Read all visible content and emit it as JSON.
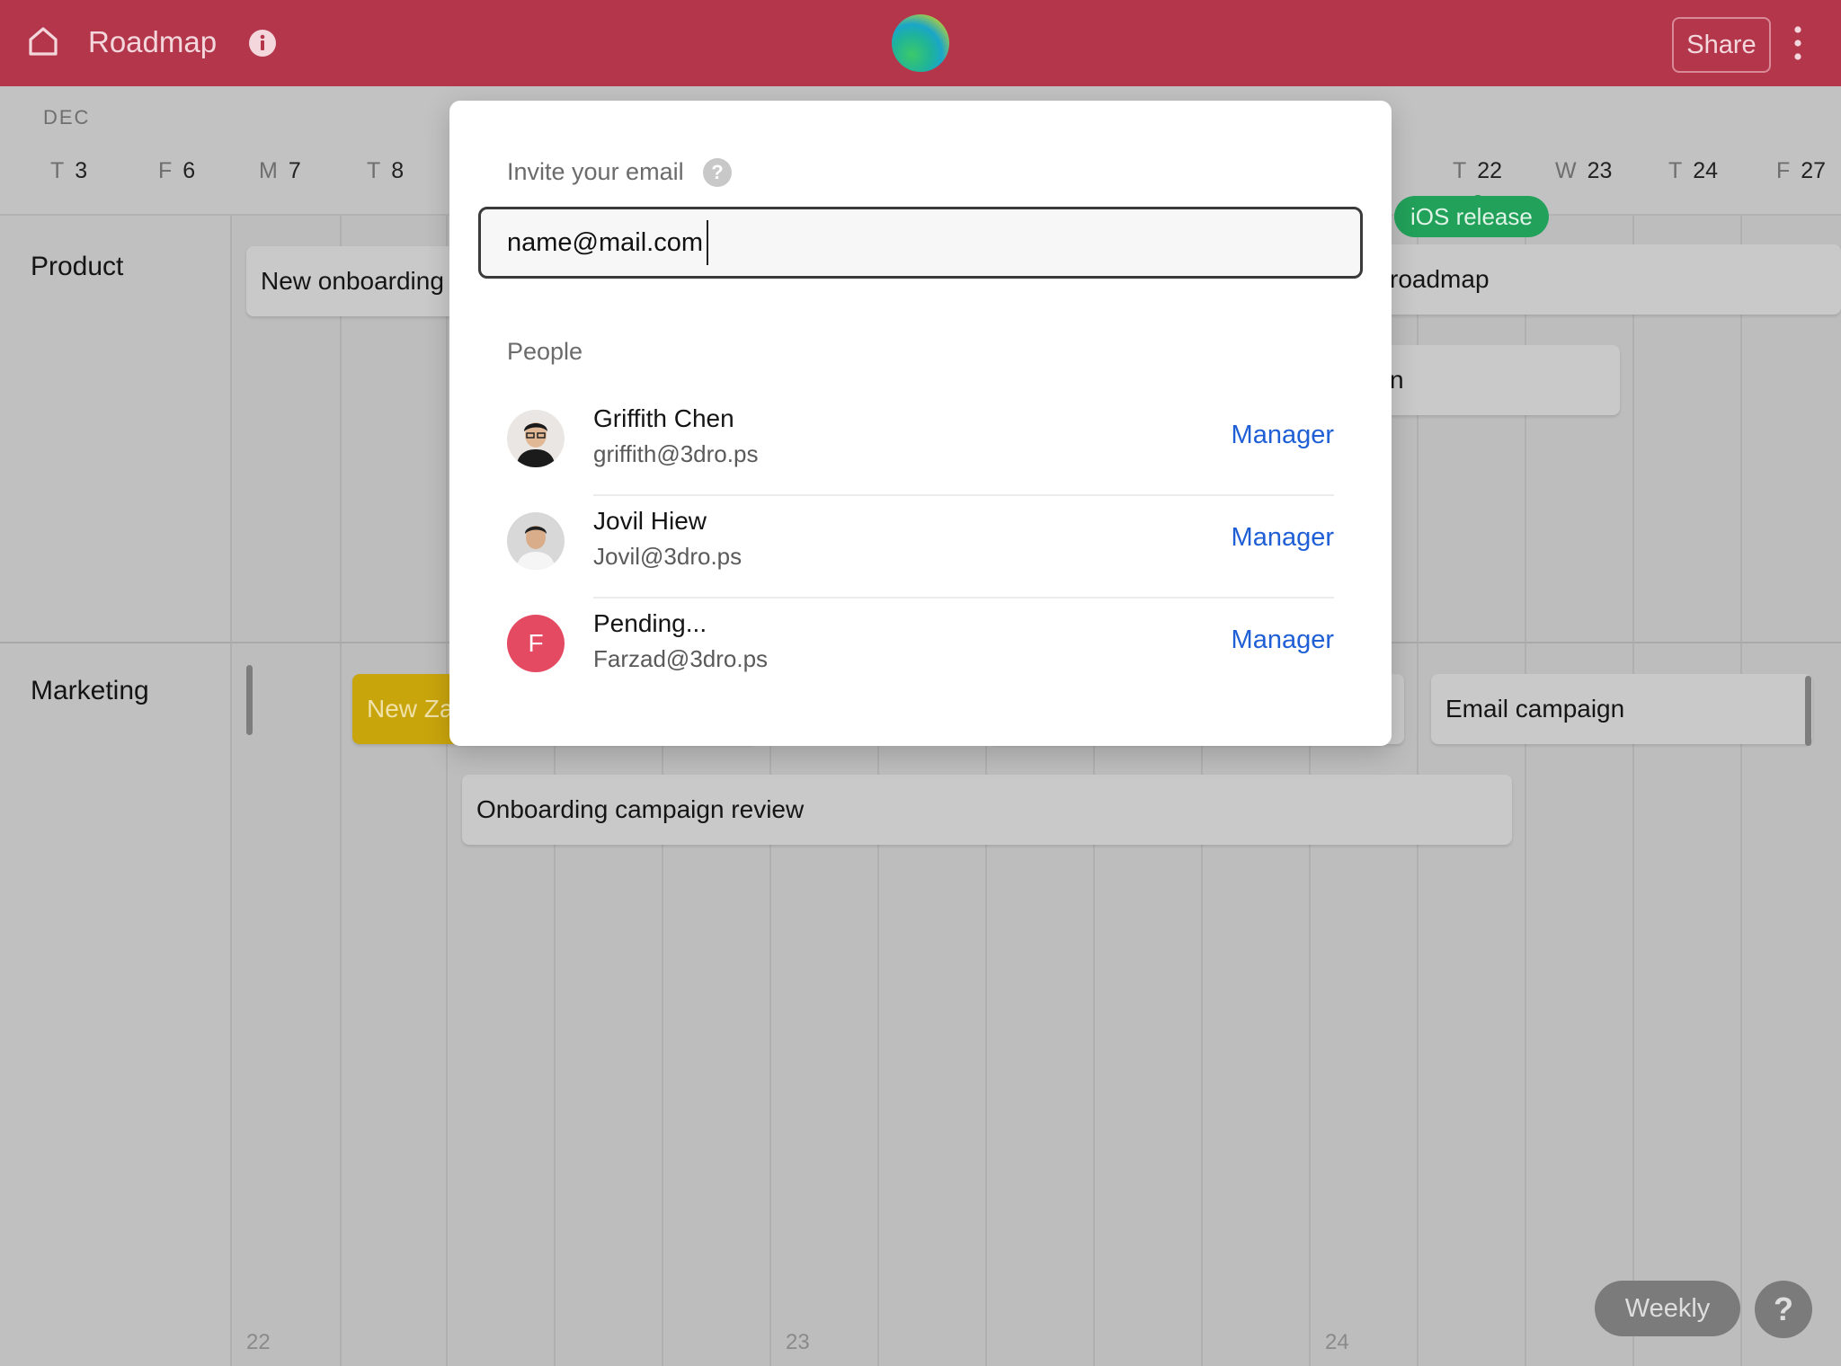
{
  "header": {
    "title": "Roadmap",
    "share_label": "Share",
    "icons": {
      "home": "home-icon",
      "info": "info-icon",
      "more": "more-vertical-icon"
    }
  },
  "timeline": {
    "month": "DEC",
    "days": [
      {
        "letter": "T",
        "num": "3"
      },
      {
        "letter": "F",
        "num": "6"
      },
      {
        "letter": "M",
        "num": "7"
      },
      {
        "letter": "T",
        "num": "8"
      },
      {
        "letter": "T",
        "num": "22"
      },
      {
        "letter": "W",
        "num": "23"
      },
      {
        "letter": "T",
        "num": "24"
      },
      {
        "letter": "F",
        "num": "27"
      }
    ],
    "milestone": "iOS release",
    "groups": {
      "product": "Product",
      "marketing": "Marketing"
    },
    "cards": {
      "new_onboarding": "New onboarding",
      "roadmap": "roadmap",
      "partial_n": "n",
      "new_za": "New Za",
      "email_campaign": "Email campaign",
      "onboarding_review": "Onboarding campaign review"
    },
    "week_numbers": [
      "22",
      "23",
      "24"
    ]
  },
  "footer": {
    "weekly_label": "Weekly",
    "help_label": "?"
  },
  "modal": {
    "invite_label": "Invite your email",
    "help_glyph": "?",
    "email_value": "name@mail.com",
    "people_label": "People",
    "people": [
      {
        "name": "Griffith Chen",
        "email": "griffith@3dro.ps",
        "role": "Manager"
      },
      {
        "name": "Jovil Hiew",
        "email": "Jovil@3dro.ps",
        "role": "Manager"
      },
      {
        "name": "Pending...",
        "email": "Farzad@3dro.ps",
        "role": "Manager",
        "initial": "F"
      }
    ]
  },
  "colors": {
    "header_bg": "#b3364b",
    "milestone_green": "#22a15a",
    "link_blue": "#1f5fd6",
    "pending_avatar": "#e44a62",
    "yellow_card": "#c9a50c"
  }
}
